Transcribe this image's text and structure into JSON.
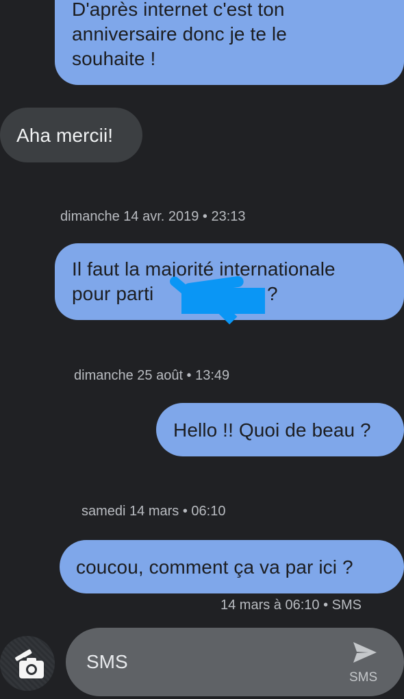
{
  "conversation": {
    "messages": [
      {
        "direction": "outgoing",
        "lines": [
          "D'après internet c'est ton",
          "anniversaire donc je te le",
          "souhaite !"
        ]
      },
      {
        "direction": "incoming",
        "lines": [
          "Aha mercii!"
        ]
      },
      {
        "direction": "outgoing",
        "lines": [
          "Il faut la majorité internationale",
          "pour parti",
          "?"
        ]
      },
      {
        "direction": "outgoing",
        "lines": [
          "Hello !! Quoi de beau ?"
        ]
      },
      {
        "direction": "outgoing",
        "lines": [
          "coucou, comment ça va par ici ?"
        ]
      }
    ],
    "timestamps": [
      "dimanche 14 avr. 2019 • 23:13",
      "dimanche 25 août • 13:49",
      "samedi 14 mars • 06:10"
    ],
    "last_status": "14 mars à 06:10 • SMS"
  },
  "compose": {
    "placeholder": "SMS",
    "send_label": "SMS",
    "attach_icon": "camera-icon",
    "send_icon": "send-icon"
  },
  "colors": {
    "background": "#202124",
    "outgoing_bubble": "#7fa7ea",
    "incoming_bubble": "#3c3f42",
    "compose_bar": "#5f6266",
    "redaction": "#0a96f5"
  }
}
